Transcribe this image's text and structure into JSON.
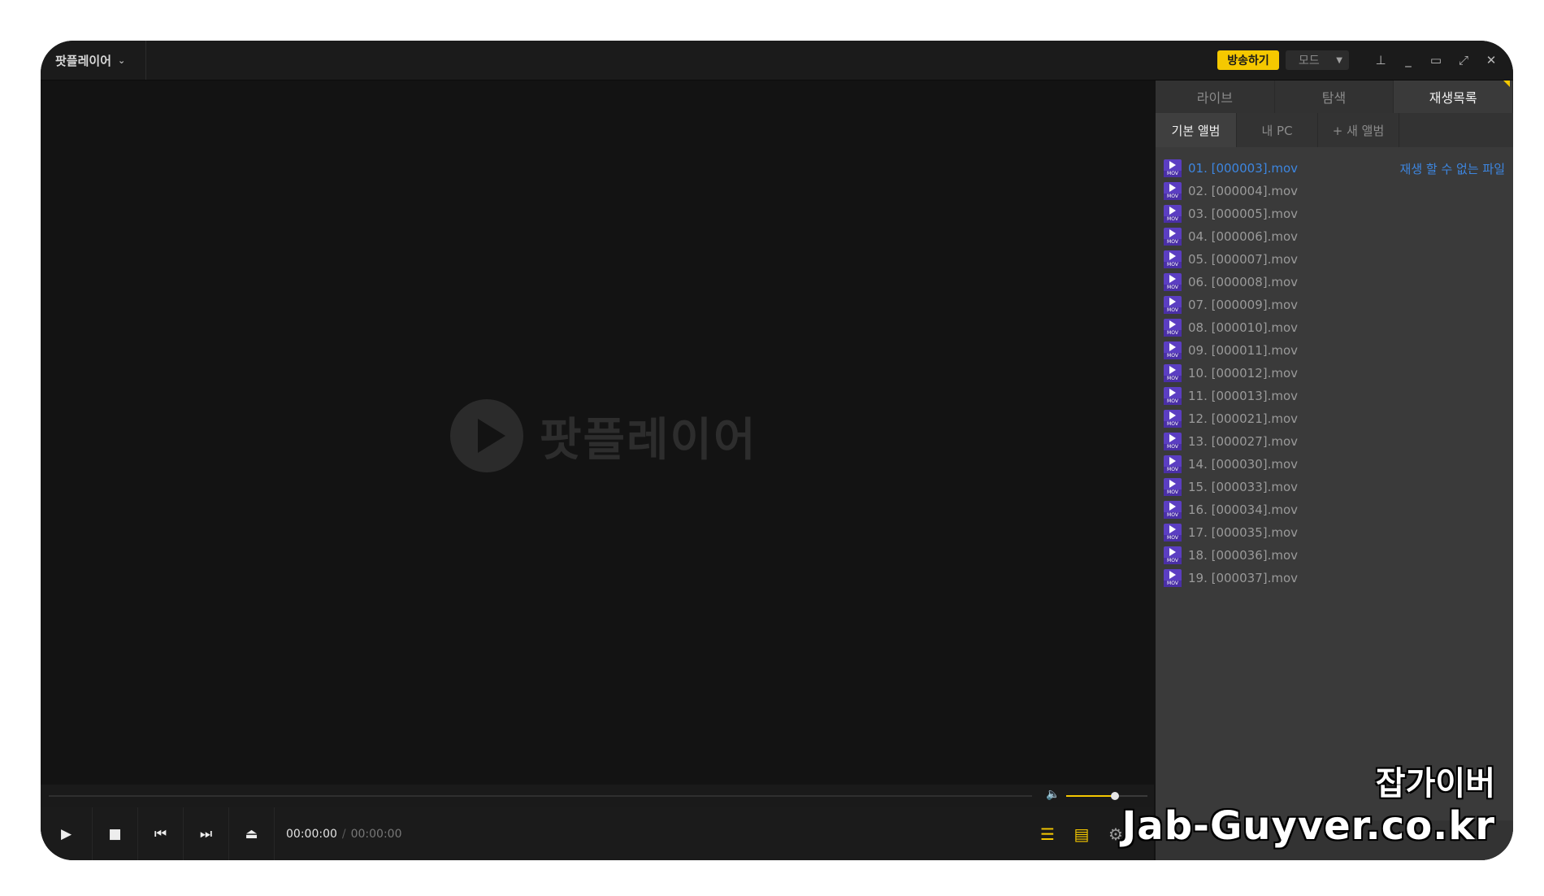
{
  "titlebar": {
    "app_name": "팟플레이어",
    "broadcast_label": "방송하기",
    "mode_label": "모드"
  },
  "window_controls": [
    "pin",
    "minimize",
    "maximize",
    "fullscreen",
    "close"
  ],
  "video": {
    "logo_text": "팟플레이어"
  },
  "controls": {
    "current_time": "00:00:00",
    "total_time": "00:00:00",
    "volume_level": 0.6
  },
  "panel": {
    "tabs": [
      "라이브",
      "탐색",
      "재생목록"
    ],
    "active_tab": 2,
    "album_tabs": [
      "기본 앨범",
      "내 PC",
      "+ 새 앨범"
    ],
    "active_album": 0,
    "items": [
      "01. [000003].mov",
      "02. [000004].mov",
      "03. [000005].mov",
      "04. [000006].mov",
      "05. [000007].mov",
      "06. [000008].mov",
      "07. [000009].mov",
      "08. [000010].mov",
      "09. [000011].mov",
      "10. [000012].mov",
      "11. [000013].mov",
      "12. [000021].mov",
      "13. [000027].mov",
      "14. [000030].mov",
      "15. [000033].mov",
      "16. [000034].mov",
      "17. [000035].mov",
      "18. [000036].mov",
      "19. [000037].mov"
    ],
    "current_item": 0,
    "current_item_status": "재생 할 수 없는 파일"
  },
  "watermark": {
    "line1": "잡가이버",
    "line2": "Jab-Guyver.co.kr"
  },
  "colors": {
    "accent": "#f5c800",
    "current_item": "#3d86e0",
    "background": "#131313"
  }
}
